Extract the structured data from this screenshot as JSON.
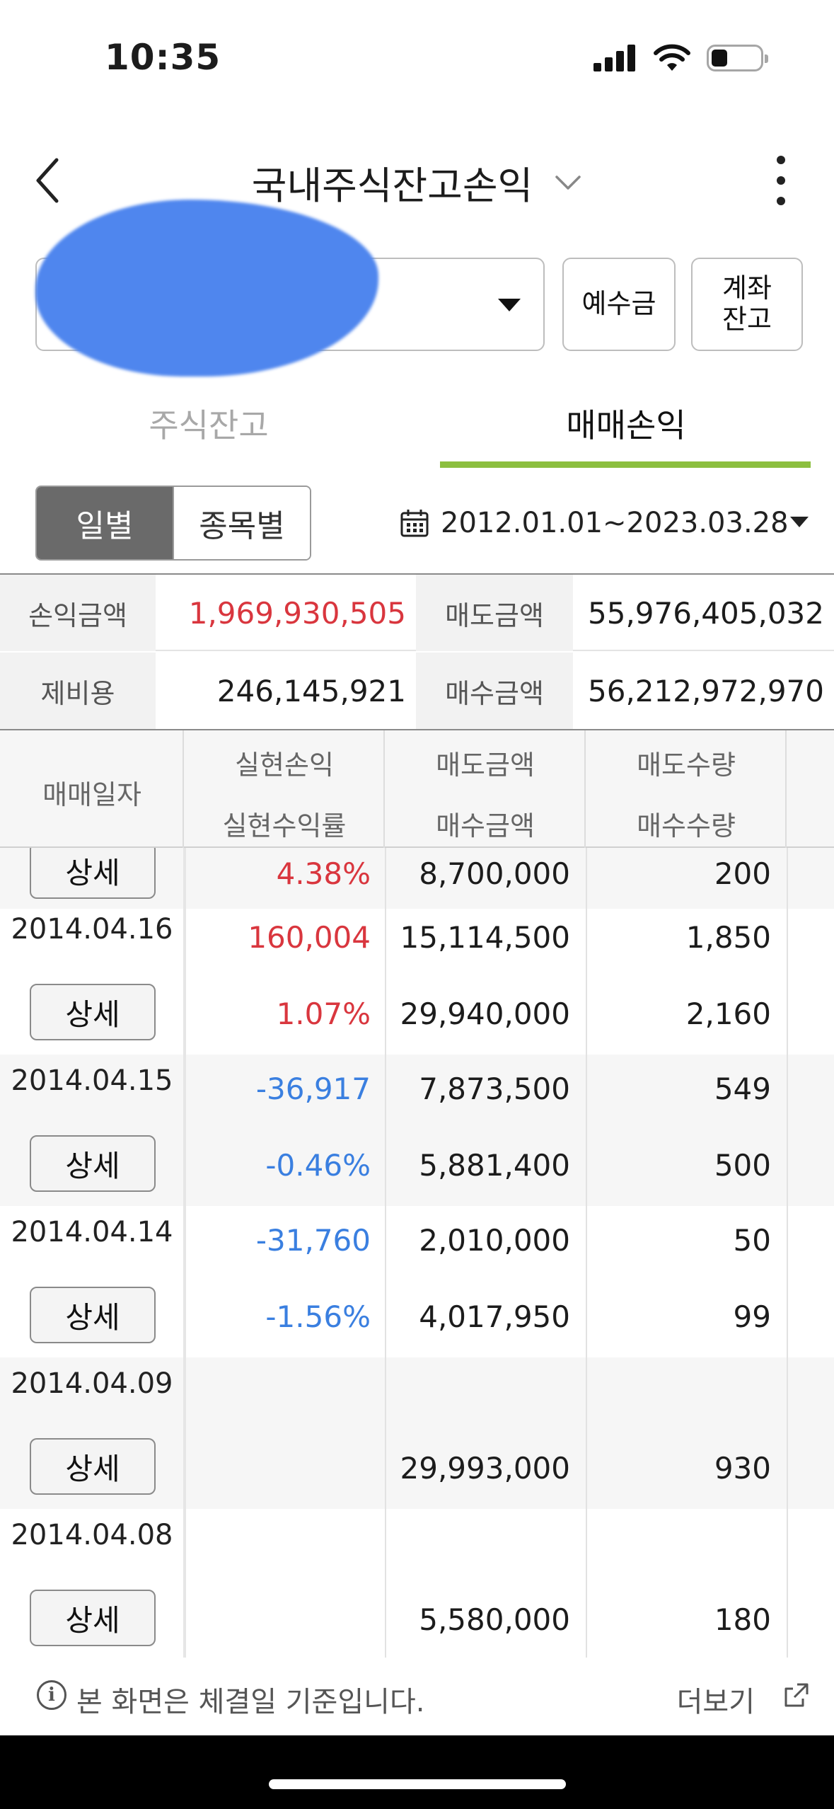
{
  "status_bar": {
    "time": "10:35"
  },
  "header": {
    "title": "국내주식잔고손익"
  },
  "account": {
    "deposit_label": "예수금",
    "balance_label_line1": "계좌",
    "balance_label_line2": "잔고"
  },
  "tabs": [
    {
      "label": "주식잔고",
      "active": false
    },
    {
      "label": "매매손익",
      "active": true
    }
  ],
  "view_toggle": {
    "daily": "일별",
    "by_stock": "종목별",
    "selected": "일별"
  },
  "date_range": "2012.01.01~2023.03.28",
  "summary": {
    "pnl_label": "손익금액",
    "pnl_value": "1,969,930,505",
    "sell_label": "매도금액",
    "sell_value": "55,976,405,032",
    "fee_label": "제비용",
    "fee_value": "246,145,921",
    "buy_label": "매수금액",
    "buy_value": "56,212,972,970"
  },
  "table": {
    "headers": {
      "date": "매매일자",
      "realized_pnl": "실현손익",
      "realized_rate": "실현수익률",
      "sell_amount": "매도금액",
      "buy_amount": "매수금액",
      "sell_qty": "매도수량",
      "buy_qty": "매수수량"
    },
    "detail_label": "상세",
    "partial_row": {
      "rate": "4.38%",
      "buy_amount": "8,700,000",
      "buy_qty": "200"
    },
    "rows": [
      {
        "date": "2014.04.16",
        "pnl": "160,004",
        "rate": "1.07%",
        "sell_amount": "15,114,500",
        "buy_amount": "29,940,000",
        "sell_qty": "1,850",
        "buy_qty": "2,160",
        "sign": "positive"
      },
      {
        "date": "2014.04.15",
        "pnl": "-36,917",
        "rate": "-0.46%",
        "sell_amount": "7,873,500",
        "buy_amount": "5,881,400",
        "sell_qty": "549",
        "buy_qty": "500",
        "sign": "negative"
      },
      {
        "date": "2014.04.14",
        "pnl": "-31,760",
        "rate": "-1.56%",
        "sell_amount": "2,010,000",
        "buy_amount": "4,017,950",
        "sell_qty": "50",
        "buy_qty": "99",
        "sign": "negative"
      },
      {
        "date": "2014.04.09",
        "pnl": "",
        "rate": "",
        "sell_amount": "",
        "buy_amount": "29,993,000",
        "sell_qty": "",
        "buy_qty": "930",
        "sign": "none"
      },
      {
        "date": "2014.04.08",
        "pnl": "",
        "rate": "",
        "sell_amount": "",
        "buy_amount": "5,580,000",
        "sell_qty": "",
        "buy_qty": "180",
        "sign": "none"
      }
    ]
  },
  "footer": {
    "note": "본 화면은 체결일 기준입니다.",
    "more": "더보기"
  },
  "colors": {
    "positive": "#d9363e",
    "negative": "#3a7fe0",
    "tab_accent": "#8cbf3f",
    "segment_active": "#6a6a6a"
  }
}
